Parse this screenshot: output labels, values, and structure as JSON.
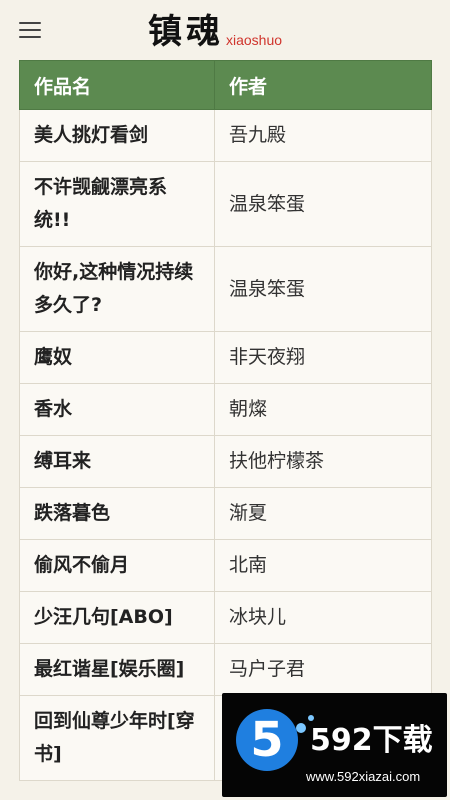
{
  "header": {
    "logo_cn": "镇魂",
    "logo_en": "xiaoshuo"
  },
  "table": {
    "col_title": "作品名",
    "col_author": "作者",
    "rows": [
      {
        "title": "美人挑灯看剑",
        "author": "吾九殿"
      },
      {
        "title": "不许觊觎漂亮系统!!",
        "author": "温泉笨蛋"
      },
      {
        "title": "你好,这种情况持续多久了?",
        "author": "温泉笨蛋"
      },
      {
        "title": "鹰奴",
        "author": "非天夜翔"
      },
      {
        "title": "香水",
        "author": "朝燦"
      },
      {
        "title": "缚耳来",
        "author": "扶他柠檬茶"
      },
      {
        "title": "跌落暮色",
        "author": "渐夏"
      },
      {
        "title": "偷风不偷月",
        "author": "北南"
      },
      {
        "title": "少汪几句[ABO]",
        "author": "冰块儿"
      },
      {
        "title": "最红谐星[娱乐圈]",
        "author": "马户子君"
      },
      {
        "title": "回到仙尊少年时[穿书]",
        "author": ""
      }
    ]
  },
  "watermark": {
    "digit": "5",
    "brand": "592下载",
    "url": "www.592xiazai.com"
  },
  "colors": {
    "header_green": "#5c8a50",
    "logo_red": "#d0342c",
    "page_bg": "#f5f2e9"
  }
}
